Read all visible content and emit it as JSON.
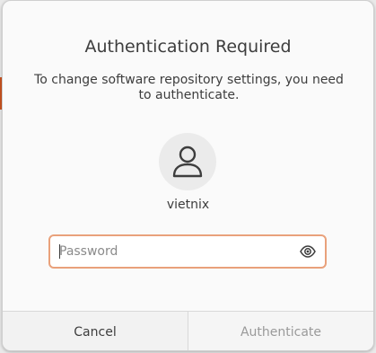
{
  "dialog": {
    "title": "Authentication Required",
    "message": "To change software repository settings, you need to authenticate.",
    "username": "vietnix",
    "password": {
      "value": "",
      "placeholder": "Password"
    },
    "buttons": {
      "cancel": "Cancel",
      "authenticate": "Authenticate"
    }
  },
  "icons": {
    "avatar": "user-icon",
    "reveal": "eye-icon"
  },
  "colors": {
    "focus_border": "#e9a17b",
    "text": "#3d3d3d",
    "disabled_text": "#9a9a9a",
    "backdrop_accent": "#c9531f"
  }
}
